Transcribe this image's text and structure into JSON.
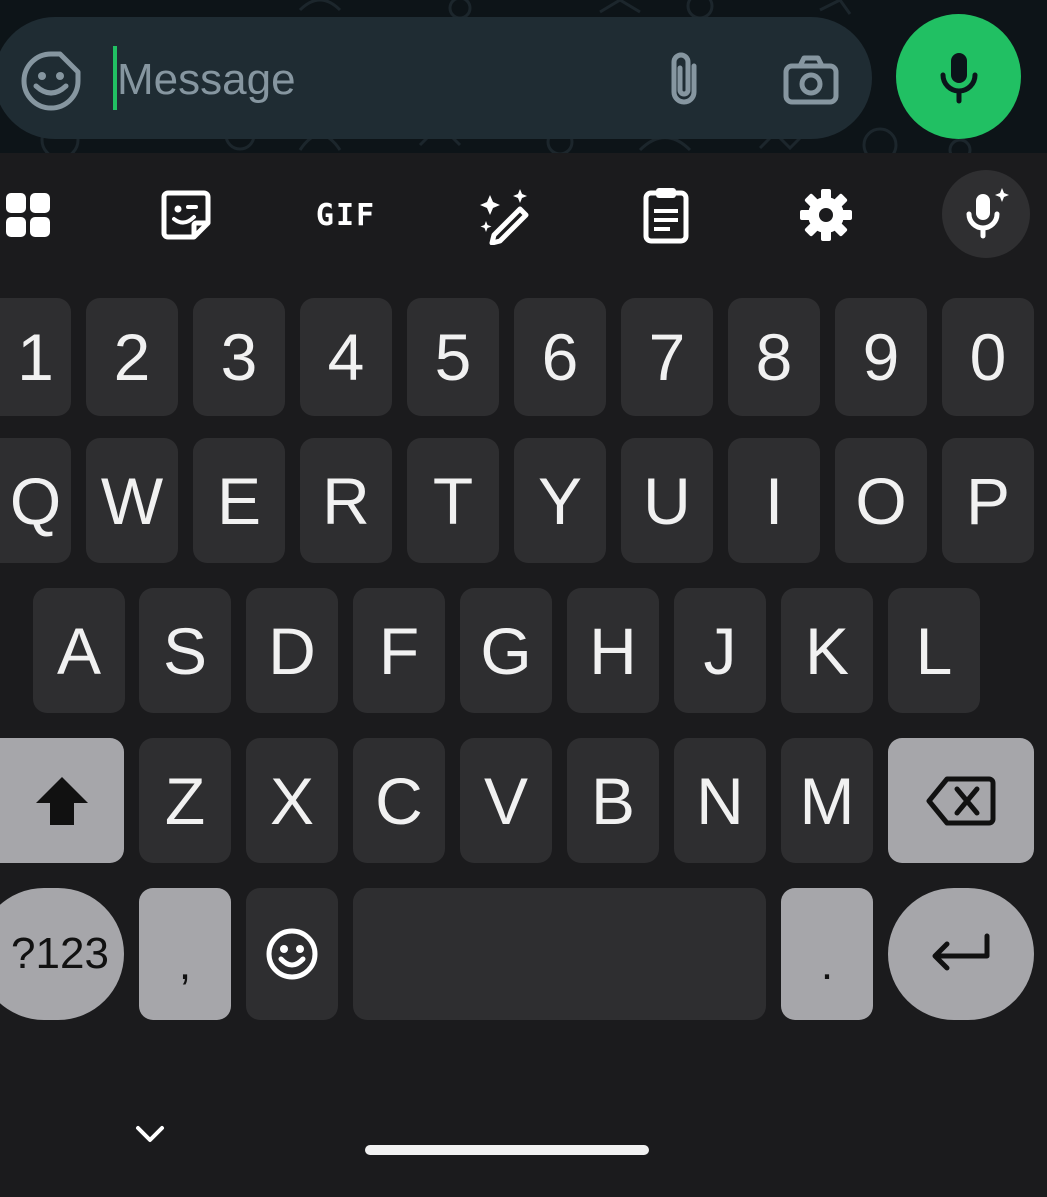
{
  "composer": {
    "placeholder": "Message"
  },
  "toolbar": {
    "items": [
      "apps-grid-icon",
      "sticker-icon",
      "gif-icon",
      "magic-write-icon",
      "clipboard-icon",
      "settings-icon",
      "voice-input-icon"
    ],
    "gif_label": "GIF"
  },
  "keyboard": {
    "row_numbers": [
      "1",
      "2",
      "3",
      "4",
      "5",
      "6",
      "7",
      "8",
      "9",
      "0"
    ],
    "row_top": [
      "Q",
      "W",
      "E",
      "R",
      "T",
      "Y",
      "U",
      "I",
      "O",
      "P"
    ],
    "row_middle": [
      "A",
      "S",
      "D",
      "F",
      "G",
      "H",
      "J",
      "K",
      "L"
    ],
    "row_bottom": [
      "Z",
      "X",
      "C",
      "V",
      "B",
      "N",
      "M"
    ],
    "symbols_label": "?123",
    "comma_label": ",",
    "period_label": "."
  },
  "colors": {
    "accent": "#21c063",
    "key_bg": "#2e2e30",
    "function_key_bg": "#a6a6aa",
    "keyboard_bg": "#1b1b1d"
  }
}
